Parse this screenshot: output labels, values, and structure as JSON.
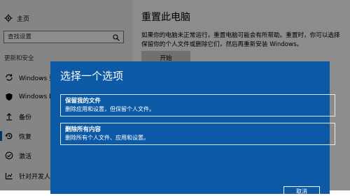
{
  "sidebar": {
    "home_label": "主页",
    "search_placeholder": "查找设置",
    "section_title": "更新和安全",
    "items": [
      {
        "label": "Windows 更新",
        "icon": "sync-icon"
      },
      {
        "label": "Windows Defender",
        "icon": "shield-icon"
      },
      {
        "label": "备份",
        "icon": "backup-icon"
      },
      {
        "label": "恢复",
        "icon": "history-icon",
        "selected": true
      },
      {
        "label": "激活",
        "icon": "check-circle-icon"
      },
      {
        "label": "针对开发人员",
        "icon": "developer-icon"
      }
    ]
  },
  "main": {
    "title": "重置此电脑",
    "description": "如果你的电脑未正常运行，重置电脑可能会有所帮助。重置时，你可以选择保留你的个人文件或删除它们，然后再重新安装 Windows。",
    "start_button": "开始"
  },
  "dialog": {
    "title": "选择一个选项",
    "options": [
      {
        "title": "保留我的文件",
        "desc": "删除应用和设置，但保留个人文件。"
      },
      {
        "title": "删除所有内容",
        "desc": "删除所有个人文件、应用和设置。"
      }
    ],
    "cancel_label": "取消"
  },
  "colors": {
    "accent": "#0063b1",
    "dialog_bg": "#0c5aa6",
    "sidebar_bg": "#f2f2f2"
  }
}
